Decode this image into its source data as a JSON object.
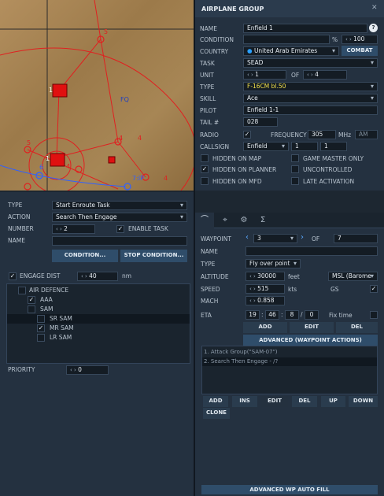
{
  "map": {
    "labels": [
      "5",
      "1",
      "FQ",
      "5",
      "4",
      "4",
      "1",
      "6",
      "4",
      "7:IP",
      "4"
    ]
  },
  "group_panel": {
    "title": "AIRPLANE GROUP",
    "name_label": "NAME",
    "name_value": "Enfield 1",
    "condition_label": "CONDITION",
    "condition_pct": "%",
    "condition_value": "100",
    "country_label": "COUNTRY",
    "country_value": "United Arab Emirates",
    "combat_button": "COMBAT",
    "task_label": "TASK",
    "task_value": "SEAD",
    "unit_label": "UNIT",
    "unit_value": "1",
    "unit_of": "OF",
    "unit_total": "4",
    "type_label": "TYPE",
    "type_value": "F-16CM bl.50",
    "skill_label": "SKILL",
    "skill_value": "Ace",
    "pilot_label": "PILOT",
    "pilot_value": "Enfield 1-1",
    "tail_label": "TAIL #",
    "tail_value": "028",
    "radio_label": "RADIO",
    "frequency_label": "FREQUENCY",
    "frequency_value": "305",
    "mhz": "MHz",
    "am": "AM",
    "callsign_label": "CALLSIGN",
    "callsign_value": "Enfield",
    "callsign_num1": "1",
    "callsign_num2": "1",
    "hidden_map": "HIDDEN ON MAP",
    "game_master": "GAME MASTER ONLY",
    "hidden_planner": "HIDDEN ON PLANNER",
    "uncontrolled": "UNCONTROLLED",
    "hidden_mfd": "HIDDEN ON MFD",
    "late_activation": "LATE ACTIVATION"
  },
  "task_panel": {
    "type_label": "TYPE",
    "type_value": "Start Enroute Task",
    "action_label": "ACTION",
    "action_value": "Search Then Engage",
    "number_label": "NUMBER",
    "number_value": "2",
    "enable_task": "ENABLE TASK",
    "name_label": "NAME",
    "condition_button": "CONDITION...",
    "stop_condition_button": "STOP CONDITION...",
    "engage_dist_label": "ENGAGE DIST",
    "engage_dist_value": "40",
    "engage_dist_unit": "nm",
    "tree": [
      "AIR DEFENCE",
      "AAA",
      "SAM",
      "SR SAM",
      "MR SAM",
      "LR SAM"
    ],
    "priority_label": "PRIORITY",
    "priority_value": "0"
  },
  "waypoint_panel": {
    "waypoint_label": "WAYPOINT",
    "waypoint_value": "3",
    "of_label": "OF",
    "waypoint_total": "7",
    "name_label": "NAME",
    "type_label": "TYPE",
    "type_value": "Fly over point",
    "altitude_label": "ALTITUDE",
    "altitude_value": "30000",
    "altitude_unit": "feet",
    "altitude_ref": "MSL (Barome",
    "speed_label": "SPEED",
    "speed_value": "515",
    "speed_unit": "kts",
    "gs_label": "GS",
    "mach_label": "MACH",
    "mach_value": "0.858",
    "eta_label": "ETA",
    "eta_h": "19",
    "eta_m": "46",
    "eta_s": "8",
    "eta_d": "0",
    "fix_time": "Fix time",
    "add": "ADD",
    "edit": "EDIT",
    "del": "DEL",
    "advanced_actions": "ADVANCED (WAYPOINT ACTIONS)",
    "actions": [
      "1. Attack Group(\"SAM-07\")",
      "2. Search Then Engage - /?"
    ],
    "btn_add": "ADD",
    "btn_ins": "INS",
    "btn_edit": "EDIT",
    "btn_del": "DEL",
    "btn_up": "UP",
    "btn_down": "DOWN",
    "btn_clone": "CLONE",
    "auto_fill": "ADVANCED WP AUTO FILL"
  }
}
